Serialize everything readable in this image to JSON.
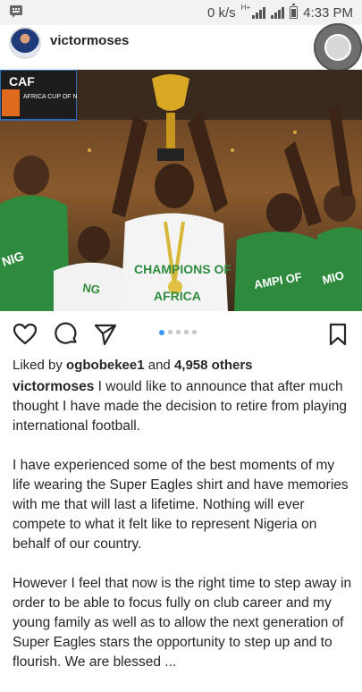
{
  "status_bar": {
    "net_speed": "0 k/s",
    "network_type": "H+",
    "time": "4:33 PM",
    "icons": [
      "notification-icon",
      "signal-icon",
      "battery-icon"
    ]
  },
  "post": {
    "username": "victormoses",
    "photo": {
      "banner_logo": "CAF",
      "banner_text": "AFRICA CUP OF NATIONS",
      "shirt_text": [
        "NIGERIA CHAMPIONS",
        "CHAMPIONS OF AFRICA",
        "CHAMPIONS OF AFRICA",
        "CHAMPIONS OF"
      ]
    },
    "carousel": {
      "count": 5,
      "active_index": 0
    },
    "likes": {
      "prefix": "Liked by ",
      "user": "ogbobekee1",
      "middle": " and ",
      "count": "4,958 others"
    },
    "caption": {
      "paragraph_1": "I would like to announce that after much thought I have made the decision to retire from playing international football.",
      "paragraph_2": "I have experienced some of the best moments of my life wearing the Super Eagles shirt and have memories with me that will last a lifetime. Nothing will ever compete to what it felt like to represent Nigeria on behalf of our country.",
      "paragraph_3": "However I feel that now is the right time to step away in order to be able to focus fully on club career and my young family as well as to allow the next generation of Super Eagles stars the opportunity to step up and to flourish. We are blessed ..."
    }
  },
  "colors": {
    "accent": "#3897f0",
    "text": "#262626",
    "status_bg": "#f2f2f2"
  }
}
